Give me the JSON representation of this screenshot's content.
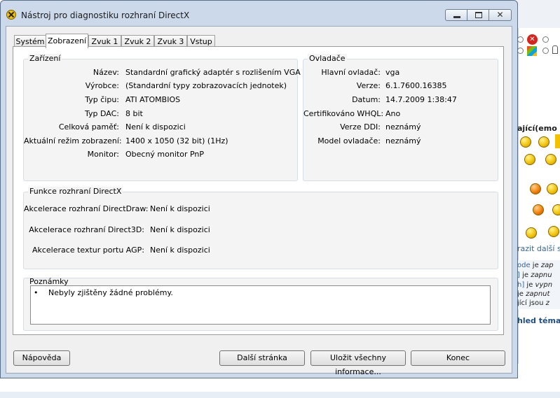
{
  "window": {
    "title": "Nástroj pro diagnostiku rozhraní DirectX"
  },
  "tabs": [
    {
      "label": "Systém"
    },
    {
      "label": "Zobrazení"
    },
    {
      "label": "Zvuk 1"
    },
    {
      "label": "Zvuk 2"
    },
    {
      "label": "Zvuk 3"
    },
    {
      "label": "Vstup"
    }
  ],
  "device": {
    "title": "Zařízení",
    "rows": [
      {
        "label": "Název:",
        "value": "Standardní grafický adaptér s rozlišením VGA"
      },
      {
        "label": "Výrobce:",
        "value": "(Standardní typy zobrazovacích jednotek)"
      },
      {
        "label": "Typ čipu:",
        "value": "ATI ATOMBIOS"
      },
      {
        "label": "Typ DAC:",
        "value": "8 bit"
      },
      {
        "label": "Celková paměť:",
        "value": "Není k dispozici"
      },
      {
        "label": "Aktuální režim zobrazení:",
        "value": "1400 x 1050 (32 bit) (1Hz)"
      },
      {
        "label": "Monitor:",
        "value": "Obecný monitor PnP"
      }
    ]
  },
  "drivers": {
    "title": "Ovladače",
    "rows": [
      {
        "label": "Hlavní ovladač:",
        "value": "vga"
      },
      {
        "label": "Verze:",
        "value": "6.1.7600.16385"
      },
      {
        "label": "Datum:",
        "value": "14.7.2009 1:38:47"
      },
      {
        "label": "Certifikováno WHQL:",
        "value": "Ano"
      },
      {
        "label": "Verze DDI:",
        "value": "neznámý"
      },
      {
        "label": "Model ovladače:",
        "value": "neznámý"
      }
    ]
  },
  "directx": {
    "title": "Funkce rozhraní DirectX",
    "rows": [
      {
        "label": "Akcelerace rozhraní DirectDraw:",
        "value": "Není k dispozici"
      },
      {
        "label": "Akcelerace rozhraní Direct3D:",
        "value": "Není k dispozici"
      },
      {
        "label": "Akcelerace textur portu AGP:",
        "value": "Není k dispozici"
      }
    ]
  },
  "notes": {
    "title": "Poznámky",
    "bullet": "•",
    "items": [
      "Nebyly zjištěny žádné problémy."
    ]
  },
  "buttons": {
    "help": "Nápověda",
    "next": "Další stránka",
    "save": "Uložit všechny informace...",
    "exit": "Konec"
  },
  "background_page": {
    "heading": "ající(emo",
    "link": "razit další s",
    "rules": [
      {
        "key": "ode",
        "text": " je ",
        "status": "zap"
      },
      {
        "key": "]",
        "text": " je ",
        "status": "zapnu"
      },
      {
        "key": "h]",
        "text": " je ",
        "status": "vypn"
      },
      {
        "key": "",
        "text": " je ",
        "status": "zapnut"
      },
      {
        "key": "",
        "text": "jící jsou ",
        "status": "z"
      }
    ],
    "footer_link": "hled téma"
  },
  "colors": {
    "window_frame": "#cbd9ea",
    "link": "#32679b"
  }
}
